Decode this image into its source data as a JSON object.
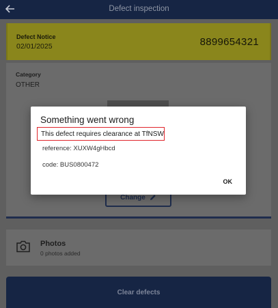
{
  "app_bar": {
    "title": "Defect inspection",
    "back_icon": "arrow-left-icon"
  },
  "notice": {
    "label": "Defect Notice",
    "date": "02/01/2025",
    "number": "8899654321",
    "color": "#8a861c"
  },
  "details": {
    "category_label": "Category",
    "category_value": "OTHER",
    "change_label": "Change",
    "change_icon": "pencil-icon"
  },
  "photos": {
    "title": "Photos",
    "subtitle": "0 photos added",
    "icon": "camera-icon"
  },
  "actions": {
    "clear_label": "Clear defects"
  },
  "dialog": {
    "title": "Something went wrong",
    "message": "This defect requires clearance at TfNSW",
    "reference": "reference: XUXW4gHbcd",
    "code": "code: BUS0800472",
    "ok_label": "OK",
    "highlight_color": "#e0242a"
  },
  "colors": {
    "primary": "#162544",
    "accent": "#8a861c"
  }
}
